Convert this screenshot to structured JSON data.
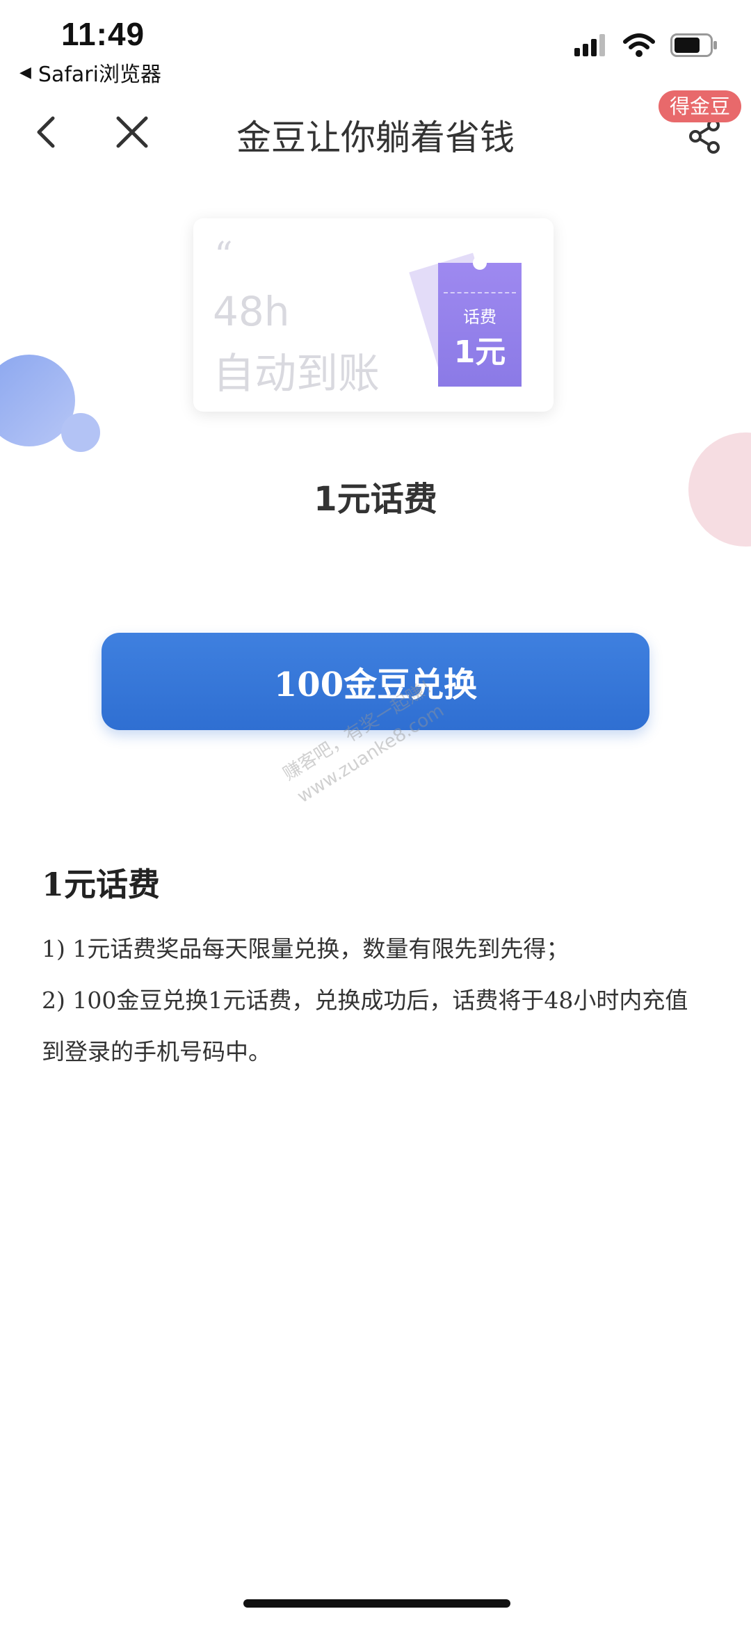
{
  "status_bar": {
    "time": "11:49",
    "back_app": "Safari浏览器",
    "signal_icon": "cellular-signal-icon",
    "wifi_icon": "wifi-icon",
    "battery_icon": "battery-icon"
  },
  "nav": {
    "title": "金豆让你躺着省钱",
    "badge": "得金豆",
    "back_icon": "chevron-left-icon",
    "close_icon": "close-icon",
    "share_icon": "share-icon"
  },
  "coupon": {
    "quote_mark": "“",
    "line1": "48h",
    "line2": "自动到账",
    "ticket_label": "话费",
    "ticket_value": "1元",
    "accent_color": "#8e7bea"
  },
  "product": {
    "name": "1元话费"
  },
  "redeem_button": {
    "label": "100金豆兑换",
    "color": "#3a78d8"
  },
  "watermark": {
    "line1": "赚客吧，有奖一起赚！",
    "line2": "www.zuanke8.com"
  },
  "description": {
    "title": "1元话费",
    "items": [
      "1) 1元话费奖品每天限量兑换，数量有限先到先得；",
      "2) 100金豆兑换1元话费，兑换成功后，话费将于48小时内充值到登录的手机号码中。"
    ]
  }
}
